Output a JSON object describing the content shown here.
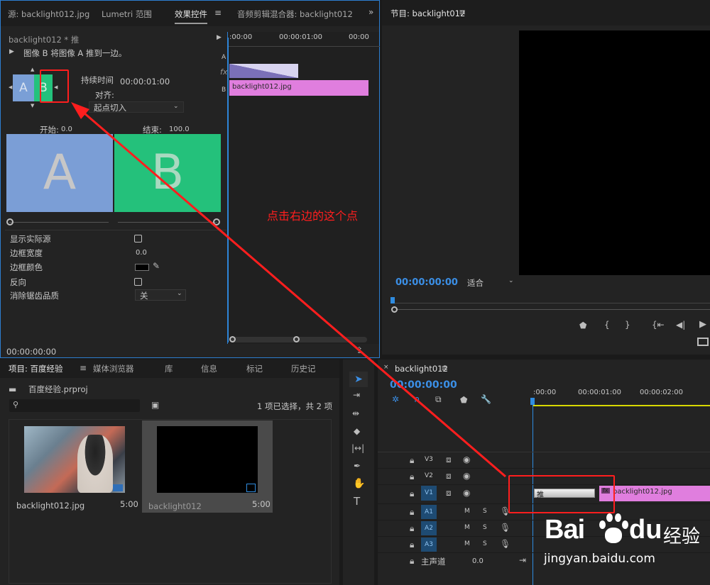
{
  "source_panel": {
    "tabs": [
      "源: backlight012.jpg",
      "Lumetri 范围",
      "效果控件",
      "音频剪辑混合器: backlight012"
    ],
    "clip_title": "backlight012 * 推",
    "description": "图像 B 将图像 A 推到一边。",
    "thumb_a": "A",
    "thumb_b": "B",
    "duration_label": "持续时间",
    "duration_value": "00:00:01:00",
    "align_label": "对齐:",
    "align_value": "起点切入",
    "start_label": "开始:",
    "start_value": "0.0",
    "end_label": "结束:",
    "end_value": "100.0",
    "preview_a": "A",
    "preview_b": "B",
    "show_actual_source": "显示实际源",
    "border_width_label": "边框宽度",
    "border_width_value": "0.0",
    "border_color_label": "边框颜色",
    "reverse_label": "反向",
    "antialias_label": "消除锯齿品质",
    "antialias_value": "关",
    "mini_ruler": [
      ":00:00",
      "00:00:01:00",
      "00:00"
    ],
    "mini_clip_name": "backlight012.jpg",
    "track_a": "A",
    "track_b": "B",
    "fx_label": "fx",
    "timecode_bottom": "00:00:00:00"
  },
  "annotation": {
    "text": "点击右边的这个点",
    "color": "#ff1e1e"
  },
  "program_panel": {
    "title": "节目: backlight012",
    "timecode": "00:00:00:00",
    "fit_value": "适合"
  },
  "project_panel": {
    "tabs": [
      "项目: 百度经验",
      "媒体浏览器",
      "库",
      "信息",
      "标记",
      "历史记"
    ],
    "project_file": "百度经验.prproj",
    "selection_info": "1 项已选择，共 2 项",
    "items": [
      {
        "name": "backlight012.jpg",
        "duration": "5:00"
      },
      {
        "name": "backlight012",
        "duration": "5:00"
      }
    ]
  },
  "timeline": {
    "title": "backlight012",
    "timecode": "00:00:00:00",
    "ruler": [
      ":00:00",
      "00:00:01:00",
      "00:00:02:00"
    ],
    "tracks": [
      {
        "id": "V3",
        "type": "video"
      },
      {
        "id": "V2",
        "type": "video"
      },
      {
        "id": "V1",
        "type": "video"
      },
      {
        "id": "A1",
        "type": "audio"
      },
      {
        "id": "A2",
        "type": "audio"
      },
      {
        "id": "A3",
        "type": "audio"
      }
    ],
    "master_label": "主声道",
    "master_value": "0.0",
    "transition_label": "推",
    "clip_name": "backlight012.jpg",
    "m_label": "M",
    "s_label": "S"
  },
  "watermark": {
    "brand": "Bai",
    "brand2": "经验",
    "url": "jingyan.baidu.com"
  },
  "colors": {
    "accent": "#2f8ce0",
    "clip_pink": "#e07ede",
    "thumb_a": "#7a9fd6",
    "thumb_b": "#23c27c",
    "annotation_red": "#ff1e1e"
  }
}
